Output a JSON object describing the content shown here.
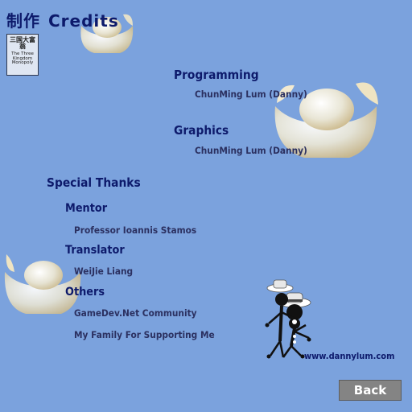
{
  "title": {
    "cn": "制作",
    "en": "Credits"
  },
  "logo": {
    "cn": "三国大富翁",
    "en_lines": [
      "The Three",
      "Kingdom",
      "Monopoly"
    ]
  },
  "programming": {
    "heading": "Programming",
    "name": "ChunMing Lum (Danny)"
  },
  "graphics": {
    "heading": "Graphics",
    "name": "ChunMing Lum (Danny)"
  },
  "special_thanks": {
    "heading": "Special Thanks",
    "mentor": {
      "label": "Mentor",
      "name": "Professor Ioannis Stamos"
    },
    "translator": {
      "label": "Translator",
      "name": "WeiJie Liang"
    },
    "others": {
      "label": "Others",
      "items": [
        "GameDev.Net Community",
        "My Family For Supporting Me"
      ]
    }
  },
  "website": "www.dannylum.com",
  "back_label": "Back",
  "colors": {
    "background": "#7ba2dd",
    "text_dark": "#0d1a6b",
    "button": "#848484"
  }
}
